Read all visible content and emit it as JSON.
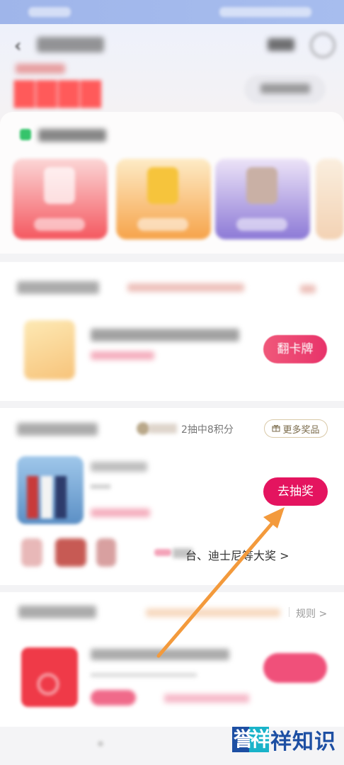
{
  "header": {
    "back_icon": "back-arrow-icon"
  },
  "flip_section": {
    "button_label": "翻卡牌"
  },
  "lottery_section": {
    "description": "2抽中8积分",
    "more_prizes_label": "更多奖品",
    "draw_button_label": "去抽奖",
    "grand_prize_text": "台、迪士尼等大奖 >"
  },
  "redpacket_section": {
    "rules_label": "规则 >"
  },
  "watermark": {
    "logo_text": "誉祥",
    "text": "祥知识"
  },
  "colors": {
    "accent_pink": "#e4145f",
    "status_bar": "#a3b9ec",
    "annotation_arrow": "#f39a3c"
  }
}
